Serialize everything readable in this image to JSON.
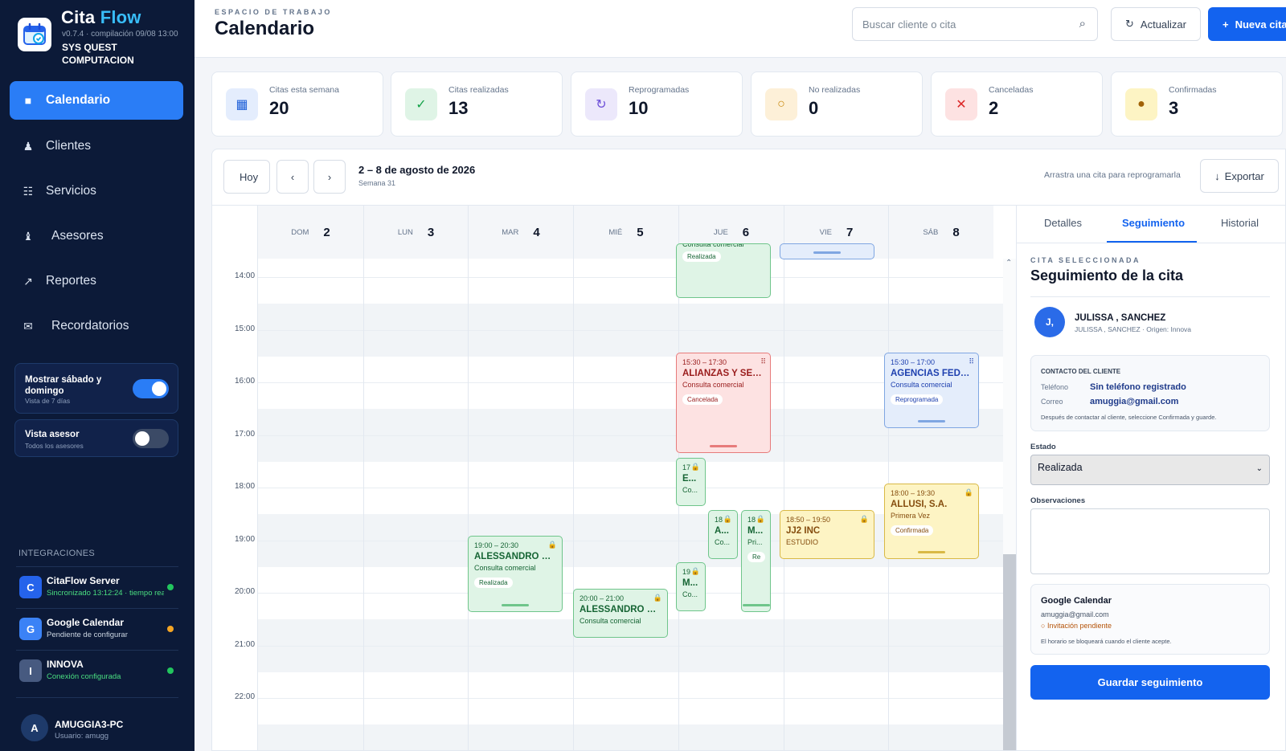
{
  "app": {
    "brand_part1": "Cita",
    "brand_part2": "Flow",
    "version": "v0.7.4 · compilación 09/08 13:00",
    "org": "SYS QUEST COMPUTACION"
  },
  "nav": [
    {
      "label": "Calendario",
      "icon": "calendar-icon",
      "active": true
    },
    {
      "label": "Clientes",
      "icon": "person-icon"
    },
    {
      "label": "Servicios",
      "icon": "list-icon"
    },
    {
      "label": "Asesores",
      "icon": "advisor-icon"
    },
    {
      "label": "Reportes",
      "icon": "trend-icon"
    },
    {
      "label": "Recordatorios",
      "icon": "mail-icon"
    }
  ],
  "toggles": [
    {
      "title": "Mostrar sábado y domingo",
      "sub": "Vista de 7 días",
      "on": true
    },
    {
      "title": "Vista asesor",
      "sub": "Todos los asesores",
      "on": false
    }
  ],
  "integrations": {
    "title": "INTEGRACIONES",
    "items": [
      {
        "initial": "C",
        "name": "CitaFlow Server",
        "status": "Sincronizado 13:12:24 · tiempo real",
        "status_color": "#4ade80",
        "dot": "#22c55e",
        "avatar_bg": "#2563eb"
      },
      {
        "initial": "G",
        "name": "Google Calendar",
        "status": "Pendiente de configurar",
        "status_color": "#cbd5e1",
        "dot": "#f5a524",
        "avatar_bg": "#3b82f6"
      },
      {
        "initial": "I",
        "name": "INNOVA",
        "status": "Conexión configurada",
        "status_color": "#4ade80",
        "dot": "#22c55e",
        "avatar_bg": "#475a80"
      }
    ]
  },
  "user": {
    "initial": "A",
    "name": "AMUGGIA3-PC",
    "sub": "Usuario: amugg"
  },
  "header": {
    "kicker": "ESPACIO DE TRABAJO",
    "title": "Calendario",
    "search_placeholder": "Buscar cliente o cita",
    "refresh": "Actualizar",
    "new": "Nueva cita"
  },
  "stats": [
    {
      "label": "Citas esta semana",
      "value": "20",
      "icon": "▦",
      "bg": "#e4edfd",
      "fg": "#1d5fd8"
    },
    {
      "label": "Citas realizadas",
      "value": "13",
      "icon": "✓",
      "bg": "#dff4e6",
      "fg": "#16a34a"
    },
    {
      "label": "Reprogramadas",
      "value": "10",
      "icon": "↻",
      "bg": "#ece8fb",
      "fg": "#6d4fd8"
    },
    {
      "label": "No realizadas",
      "value": "0",
      "icon": "○",
      "bg": "#fdf0d8",
      "fg": "#c98a0f"
    },
    {
      "label": "Canceladas",
      "value": "2",
      "icon": "✕",
      "bg": "#fde2e2",
      "fg": "#dc2626"
    },
    {
      "label": "Confirmadas",
      "value": "3",
      "icon": "●",
      "bg": "#fdf4c4",
      "fg": "#a16207"
    }
  ],
  "toolbar": {
    "today": "Hoy",
    "prev": "‹",
    "next": "›",
    "range": "2 – 8 de agosto de 2026",
    "week": "Semana 31",
    "hint": "Arrastra una cita para reprogramarla",
    "export": "Exportar"
  },
  "days": [
    {
      "name": "DOM",
      "num": "2"
    },
    {
      "name": "LUN",
      "num": "3"
    },
    {
      "name": "MAR",
      "num": "4"
    },
    {
      "name": "MIÉ",
      "num": "5"
    },
    {
      "name": "JUE",
      "num": "6"
    },
    {
      "name": "VIE",
      "num": "7"
    },
    {
      "name": "SÁB",
      "num": "8"
    }
  ],
  "hours": [
    "14:00",
    "15:00",
    "16:00",
    "17:00",
    "18:00",
    "19:00",
    "20:00",
    "21:00",
    "22:00"
  ],
  "events": [
    {
      "time": "",
      "name": "",
      "service": "Consulta comercial",
      "badge": "Realizada",
      "color": "green"
    },
    {
      "time": "",
      "name": "",
      "service": "",
      "badge": "",
      "color": "blue"
    },
    {
      "time": "15:30 – 17:30",
      "name": "ALIANZAS Y SERV...",
      "service": "Consulta comercial",
      "badge": "Cancelada",
      "color": "red"
    },
    {
      "time": "15:30 – 17:00",
      "name": "AGENCIAS FEDUR...",
      "service": "Consulta comercial",
      "badge": "Reprogramada",
      "color": "blue"
    },
    {
      "time": "17",
      "name": "E...",
      "service": "Co...",
      "badge": "",
      "color": "green"
    },
    {
      "time": "18:00 – 19:30",
      "name": "ALLUSI, S.A.",
      "service": "Primera Vez",
      "badge": "Confirmada",
      "color": "yellow"
    },
    {
      "time": "18",
      "name": "A...",
      "service": "Co...",
      "badge": "",
      "color": "green"
    },
    {
      "time": "18",
      "name": "M...",
      "service": "Pri...",
      "badge": "Re",
      "color": "green"
    },
    {
      "time": "18:50 – 19:50",
      "name": "JJ2 INC",
      "service": "ESTUDIO",
      "badge": "",
      "color": "yellow"
    },
    {
      "time": "19:00 – 20:30",
      "name": "ALESSANDRO MA...",
      "service": "Consulta comercial",
      "badge": "Realizada",
      "color": "green"
    },
    {
      "time": "19",
      "name": "M...",
      "service": "Co...",
      "badge": "",
      "color": "green"
    },
    {
      "time": "20:00 – 21:00",
      "name": "ALESSANDRO MA...",
      "service": "Consulta comercial",
      "badge": "",
      "color": "green"
    }
  ],
  "panel": {
    "tabs": [
      "Detalles",
      "Seguimiento",
      "Historial"
    ],
    "kicker": "CITA SELECCIONADA",
    "title": "Seguimiento de la cita",
    "client_initial": "J,",
    "client_name": "JULISSA ,  SANCHEZ",
    "client_sub": "JULISSA ,  SANCHEZ · Origen: Innova",
    "contact_title": "CONTACTO DEL CLIENTE",
    "phone_label": "Teléfono",
    "phone_value": "Sin teléfono registrado",
    "email_label": "Correo",
    "email_value": "amuggia@gmail.com",
    "contact_note": "Después de contactar al cliente, seleccione Confirmada y guarde.",
    "status_label": "Estado",
    "status_value": "Realizada",
    "obs_label": "Observaciones",
    "gcal_title": "Google Calendar",
    "gcal_email": "amuggia@gmail.com",
    "gcal_status": "Invitación pendiente",
    "gcal_note": "El horario se bloqueará cuando el cliente acepte.",
    "save": "Guardar seguimiento"
  }
}
